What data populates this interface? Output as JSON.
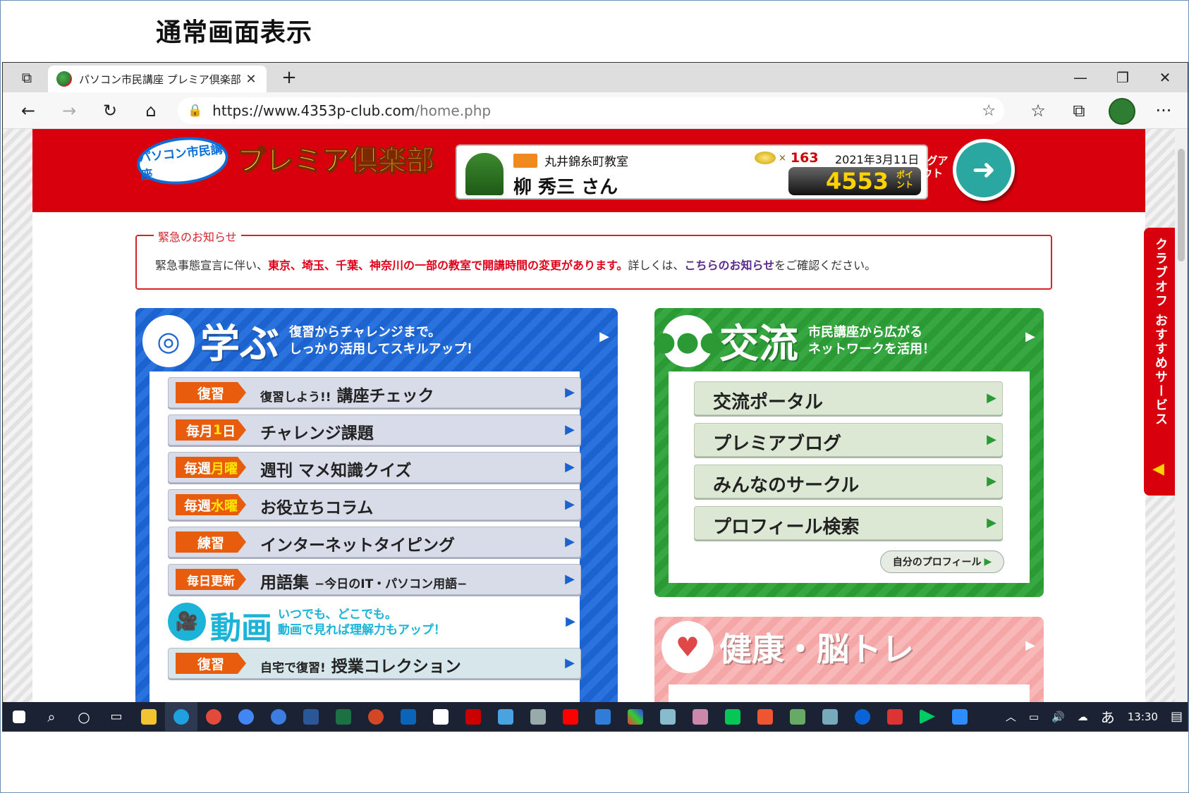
{
  "heading": "通常画面表示",
  "browser": {
    "tab_title": "パソコン市民講座 プレミア倶楽部 - |",
    "tab_close": "✕",
    "new_tab": "+",
    "minimize": "—",
    "restore": "❐",
    "close": "✕",
    "back": "←",
    "forward": "→",
    "refresh": "↻",
    "home": "⌂",
    "url_host": "https://www.4353p-club.com",
    "url_path": "/home.php",
    "favorites": "☆",
    "collections": "⧉",
    "more": "···"
  },
  "header": {
    "logo_text": "パソコン市民講座",
    "brand": "プレミア倶楽部",
    "school": "丸井錦糸町教室",
    "user_name": "柳 秀三 さん",
    "coin_times": "×",
    "coin_count": "163",
    "date": "2021年3月11日",
    "points": "4553",
    "points_unit": "ポイント",
    "logout_label": "ログアウト"
  },
  "notice": {
    "title": "緊急のお知らせ",
    "prefix": "緊急事態宣言に伴い、",
    "highlight": "東京、埼玉、千葉、神奈川の一部の教室で開講時間の変更があります。",
    "middle": "詳しくは、",
    "link": "こちらのお知らせ",
    "suffix": "をご確認ください。"
  },
  "learn": {
    "title": "学ぶ",
    "sub1": "復習からチャレンジまで。",
    "sub2": "しっかり活用してスキルアップ！",
    "rows": [
      {
        "tag": "復習",
        "label": "講座チェック",
        "pre": "復習しよう!!"
      },
      {
        "tag_a": "毎月",
        "tag_y": "1",
        "tag_b": "日",
        "label": "チャレンジ課題"
      },
      {
        "tag_a": "毎週",
        "tag_y": "月曜",
        "label": "週刊 マメ知識クイズ"
      },
      {
        "tag_a": "毎週",
        "tag_y": "水曜",
        "label": "お役立ちコラム"
      },
      {
        "tag": "練習",
        "label": "インターネットタイピング"
      },
      {
        "tag": "毎日更新",
        "label": "用語集",
        "post": "−今日のIT・パソコン用語−"
      }
    ],
    "video_title": "動画",
    "video_sub1": "いつでも、どこでも。",
    "video_sub2": "動画で見れば理解力もアップ！",
    "video_row": {
      "tag": "復習",
      "pre": "自宅で復習!",
      "label": "授業コレクション"
    }
  },
  "community": {
    "title": "交流",
    "sub1": "市民講座から広がる",
    "sub2": "ネットワークを活用！",
    "items": [
      "交流ポータル",
      "プレミアブログ",
      "みんなのサークル",
      "プロフィール検索"
    ],
    "profile_button": "自分のプロフィール"
  },
  "health": {
    "title": "健康・脳トレ"
  },
  "side_tab": "クラブオフ おすすめサービス",
  "taskbar": {
    "ime": "あ",
    "clock": "13:30"
  },
  "colors": {
    "header_red": "#d9000e",
    "learn_blue": "#1c63d0",
    "comm_green": "#2b9a35",
    "health_pink": "#f5a6a6",
    "tag_orange": "#e85c0d"
  }
}
